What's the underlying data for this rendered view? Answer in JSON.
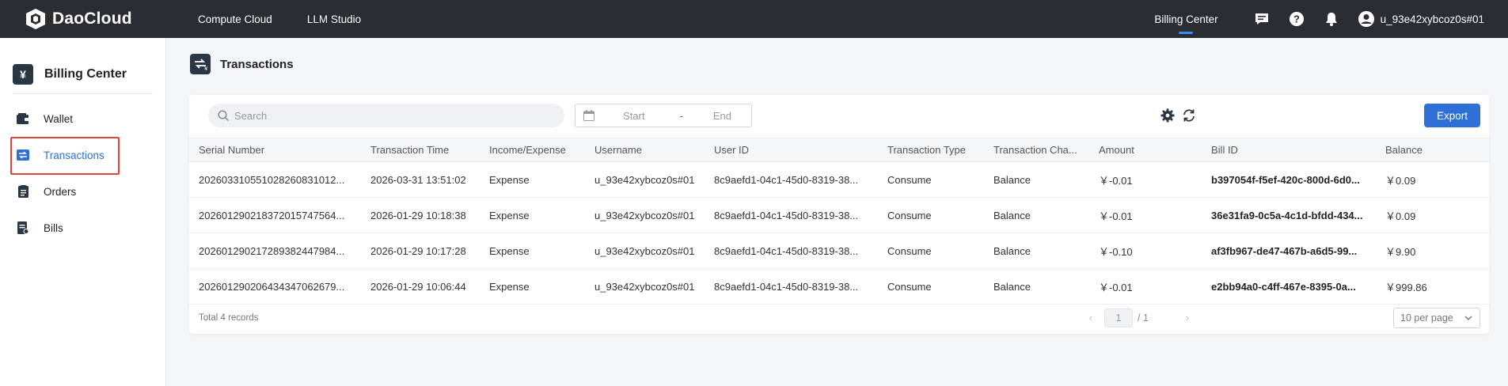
{
  "brand": {
    "name": "DaoCloud"
  },
  "topnav": {
    "items": [
      "Compute Cloud",
      "LLM Studio"
    ],
    "active": "Billing Center",
    "username": "u_93e42xybcoz0s#01"
  },
  "sidebar": {
    "title": "Billing Center",
    "items": [
      {
        "label": "Wallet"
      },
      {
        "label": "Transactions"
      },
      {
        "label": "Orders"
      },
      {
        "label": "Bills"
      }
    ]
  },
  "page": {
    "title": "Transactions"
  },
  "toolbar": {
    "search_placeholder": "Search",
    "start": "Start",
    "separator": "-",
    "end": "End",
    "export_label": "Export"
  },
  "table": {
    "columns": [
      "Serial Number",
      "Transaction Time",
      "Income/Expense",
      "Username",
      "User ID",
      "Transaction Type",
      "Transaction Cha...",
      "Amount",
      "Bill ID",
      "Balance"
    ],
    "rows": [
      [
        "202603310551028260831012...",
        "2026-03-31 13:51:02",
        "Expense",
        "u_93e42xybcoz0s#01",
        "8c9aefd1-04c1-45d0-8319-38...",
        "Consume",
        "Balance",
        "￥-0.01",
        "b397054f-f5ef-420c-800d-6d0...",
        "￥0.09"
      ],
      [
        "202601290218372015747564...",
        "2026-01-29 10:18:38",
        "Expense",
        "u_93e42xybcoz0s#01",
        "8c9aefd1-04c1-45d0-8319-38...",
        "Consume",
        "Balance",
        "￥-0.01",
        "36e31fa9-0c5a-4c1d-bfdd-434...",
        "￥0.09"
      ],
      [
        "202601290217289382447984...",
        "2026-01-29 10:17:28",
        "Expense",
        "u_93e42xybcoz0s#01",
        "8c9aefd1-04c1-45d0-8319-38...",
        "Consume",
        "Balance",
        "￥-0.10",
        "af3fb967-de47-467b-a6d5-99...",
        "￥9.90"
      ],
      [
        "202601290206434347062679...",
        "2026-01-29 10:06:44",
        "Expense",
        "u_93e42xybcoz0s#01",
        "8c9aefd1-04c1-45d0-8319-38...",
        "Consume",
        "Balance",
        "￥-0.01",
        "e2bb94a0-c4ff-467e-8395-0a...",
        "￥999.86"
      ]
    ]
  },
  "footer": {
    "total": "Total 4 records",
    "page": "1",
    "page_of": "/ 1",
    "page_size": "10 per page"
  },
  "colors": {
    "topbar": "#2b2d32",
    "accent": "#2f6fd8",
    "highlight": "#e0443e"
  }
}
